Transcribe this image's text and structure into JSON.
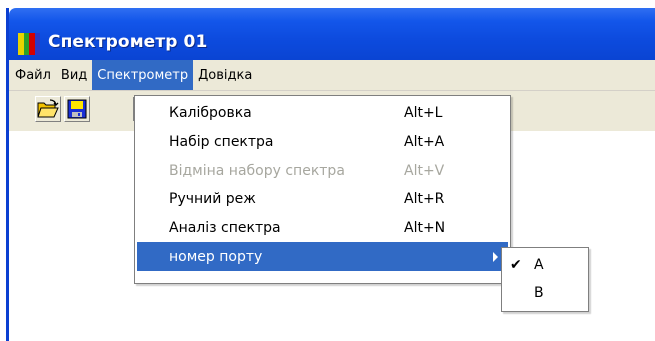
{
  "window": {
    "title": "Спектрометр 01",
    "icon_name": "spectrum-app-icon",
    "icon_colors": [
      "#e8d400",
      "#2aa02a",
      "#d40000",
      "#2a39c8"
    ]
  },
  "menubar": {
    "items": [
      {
        "label": "Файл"
      },
      {
        "label": "Вид"
      },
      {
        "label": "Спектрометр"
      },
      {
        "label": "Довідка"
      }
    ],
    "active_index": 2
  },
  "toolbar": {
    "buttons": [
      {
        "icon": "open-folder-icon"
      },
      {
        "icon": "save-disk-icon"
      }
    ]
  },
  "dropdown": {
    "items": [
      {
        "label": "Калібровка",
        "shortcut": "Alt+L",
        "enabled": true
      },
      {
        "label": "Набір спектра",
        "shortcut": "Alt+A",
        "enabled": true
      },
      {
        "label": "Відміна набору спектра",
        "shortcut": "Alt+V",
        "enabled": false
      },
      {
        "label": "Ручний реж",
        "shortcut": "Alt+R",
        "enabled": true
      },
      {
        "label": "Аналіз спектра",
        "shortcut": "Alt+N",
        "enabled": true
      },
      {
        "label": "номер порту",
        "shortcut": "",
        "enabled": true,
        "has_submenu": true,
        "highlighted": true
      }
    ]
  },
  "submenu": {
    "items": [
      {
        "label": "A",
        "checked": true,
        "check_glyph": "✔"
      },
      {
        "label": "B",
        "checked": false,
        "check_glyph": ""
      }
    ]
  },
  "colors": {
    "titlebar": "#0d4bde",
    "menu_highlight": "#316ac5",
    "menubar_bg": "#ece9d8",
    "disabled_text": "#a7a79f"
  }
}
